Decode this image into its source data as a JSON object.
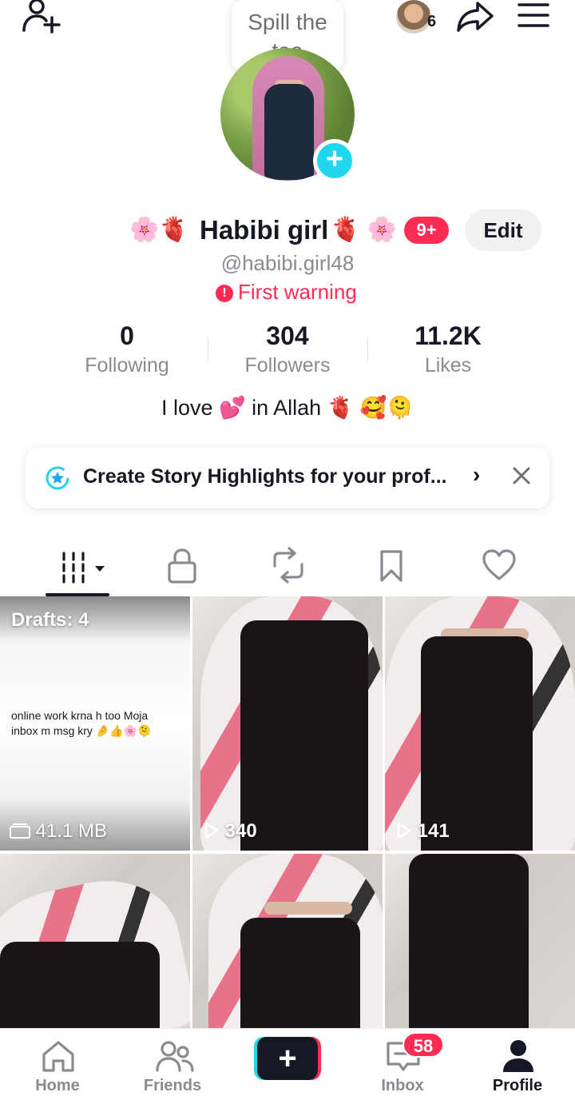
{
  "top_bar": {
    "story_bubble_line1": "Spill the",
    "story_bubble_line2": "tea",
    "visitor_count": "6"
  },
  "profile": {
    "name": "Habibi girl",
    "name_decoration_left": "🌸🫀",
    "name_decoration_right": "🫀 🌸",
    "notification_badge": "9+",
    "edit_label": "Edit",
    "handle": "@habibi.girl48",
    "warning": "First warning",
    "bio": "I love 💕 in Allah 🫀 🥰🫠"
  },
  "stats": [
    {
      "value": "0",
      "label": "Following"
    },
    {
      "value": "304",
      "label": "Followers"
    },
    {
      "value": "11.2K",
      "label": "Likes"
    }
  ],
  "highlight_card": {
    "text": "Create Story Highlights for your prof...",
    "chevron": "›"
  },
  "tabs": [
    "videos-tab",
    "private-tab",
    "reposts-tab",
    "favorites-tab",
    "liked-tab"
  ],
  "grid": {
    "drafts_label": "Drafts: 4",
    "draft_caption": "online work krna h too Moja inbox m msg kry 🤌👍🌸🫠",
    "draft_size": "41.1 MB",
    "video_views": [
      "340",
      "141"
    ]
  },
  "bottom_nav": {
    "items": [
      {
        "label": "Home"
      },
      {
        "label": "Friends"
      },
      {
        "label": "Inbox"
      },
      {
        "label": "Profile"
      }
    ],
    "inbox_badge": "58"
  },
  "colors": {
    "accent_red": "#fe2c55",
    "accent_cyan": "#20d5ec",
    "text_primary": "#161823",
    "text_secondary": "#8a8b91"
  }
}
